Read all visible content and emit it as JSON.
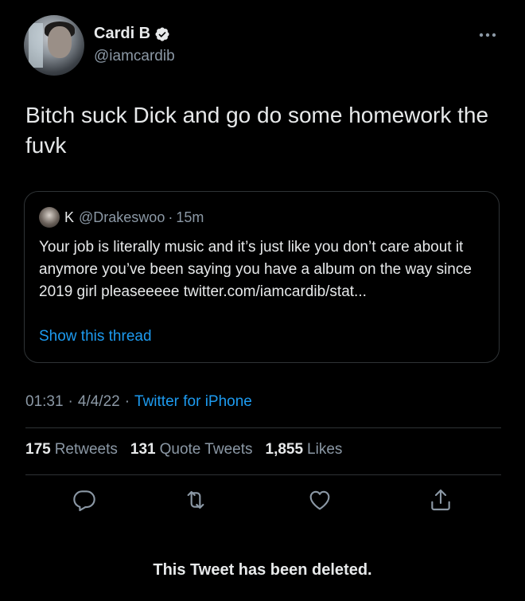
{
  "colors": {
    "background": "#000000",
    "text_primary": "#e7e9ea",
    "text_secondary": "#8b98a5",
    "accent": "#1d9bf0",
    "divider": "#2f3336"
  },
  "author": {
    "display_name": "Cardi B",
    "handle": "@iamcardib",
    "verified_icon": "verified-badge-icon",
    "avatar_icon": "profile-photo"
  },
  "tweet": {
    "text": "Bitch suck Dick and go do some homework the fuvk"
  },
  "quoted_tweet": {
    "prefix_icon": "k-letter-icon",
    "prefix": "K",
    "handle": "@Drakeswoo",
    "separator": "·",
    "time": "15m",
    "text": "Your job is literally music and it’s just like you don’t care about it anymore you’ve been saying you have a album on the way since 2019 girl pleaseeeee twitter.com/iamcardib/stat...",
    "show_thread_label": "Show this thread"
  },
  "meta": {
    "time": "01:31",
    "date": "4/4/22",
    "separator": "·",
    "source": "Twitter for iPhone"
  },
  "stats": {
    "retweets_count": "175",
    "retweets_label": "Retweets",
    "quotes_count": "131",
    "quotes_label": "Quote Tweets",
    "likes_count": "1,855",
    "likes_label": "Likes"
  },
  "actions": [
    "reply-icon",
    "retweet-icon",
    "like-icon",
    "share-icon"
  ],
  "notice": "This Tweet has been deleted."
}
